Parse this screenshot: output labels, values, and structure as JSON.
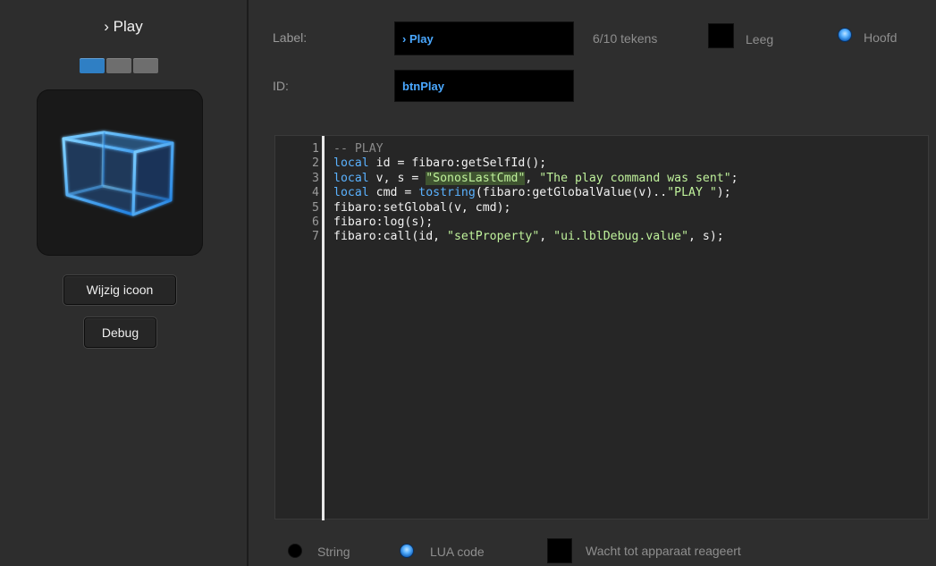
{
  "left": {
    "title": "› Play",
    "pager": [
      "page-1",
      "page-2",
      "page-3"
    ],
    "pager_active": 0,
    "icon": "cube-icon",
    "change_icon_label": "Wijzig icoon",
    "debug_label": "Debug"
  },
  "form": {
    "label_caption": "Label:",
    "label_value": "› Play",
    "id_caption": "ID:",
    "id_value": "btnPlay",
    "counter": "6/10 tekens",
    "empty_label": "Leeg",
    "main_label": "Hoofd",
    "main_selected": true,
    "empty_checked": false
  },
  "code": {
    "lines": [
      {
        "n": "1",
        "text": "-- PLAY"
      },
      {
        "n": "2",
        "text": "local id = fibaro:getSelfId();"
      },
      {
        "n": "3",
        "text": "local v, s = \"SonosLastCmd\", \"The play command was sent\";"
      },
      {
        "n": "4",
        "text": "local cmd = tostring(fibaro:getGlobalValue(v)..\"PLAY \");"
      },
      {
        "n": "5",
        "text": "fibaro:setGlobal(v, cmd);"
      },
      {
        "n": "6",
        "text": "fibaro:log(s);"
      },
      {
        "n": "7",
        "text": "fibaro:call(id, \"setProperty\", \"ui.lblDebug.value\", s);"
      }
    ]
  },
  "bottom": {
    "string_label": "String",
    "lua_label": "LUA code",
    "wait_label": "Wacht tot apparaat reageert",
    "selected": "lua",
    "wait_checked": false
  },
  "colors": {
    "accent": "#2f7fc4",
    "keyword": "#5ab2ff",
    "string": "#bff19b",
    "comment": "#8a8a8a"
  }
}
